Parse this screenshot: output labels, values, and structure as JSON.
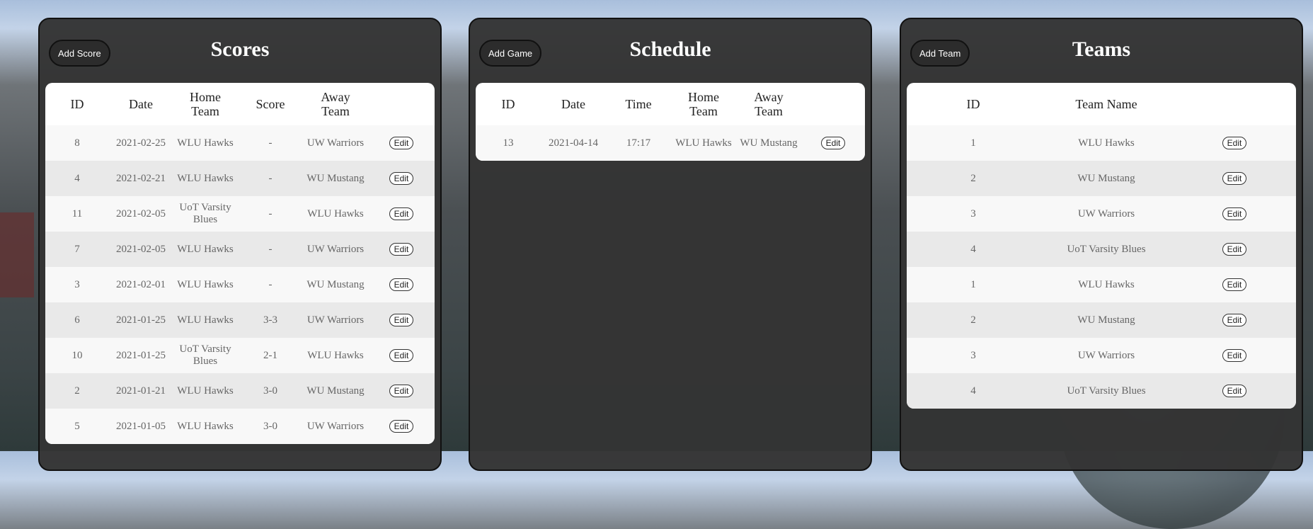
{
  "scores": {
    "title": "Scores",
    "add_label": "Add Score",
    "headers": [
      "ID",
      "Date",
      "Home Team",
      "Score",
      "Away Team"
    ],
    "edit_label": "Edit",
    "rows": [
      {
        "id": "8",
        "date": "2021-02-25",
        "home": "WLU Hawks",
        "score": "-",
        "away": "UW Warriors"
      },
      {
        "id": "4",
        "date": "2021-02-21",
        "home": "WLU Hawks",
        "score": "-",
        "away": "WU Mustang"
      },
      {
        "id": "11",
        "date": "2021-02-05",
        "home": "UoT Varsity Blues",
        "score": "-",
        "away": "WLU Hawks"
      },
      {
        "id": "7",
        "date": "2021-02-05",
        "home": "WLU Hawks",
        "score": "-",
        "away": "UW Warriors"
      },
      {
        "id": "3",
        "date": "2021-02-01",
        "home": "WLU Hawks",
        "score": "-",
        "away": "WU Mustang"
      },
      {
        "id": "6",
        "date": "2021-01-25",
        "home": "WLU Hawks",
        "score": "3-3",
        "away": "UW Warriors"
      },
      {
        "id": "10",
        "date": "2021-01-25",
        "home": "UoT Varsity Blues",
        "score": "2-1",
        "away": "WLU Hawks"
      },
      {
        "id": "2",
        "date": "2021-01-21",
        "home": "WLU Hawks",
        "score": "3-0",
        "away": "WU Mustang"
      },
      {
        "id": "5",
        "date": "2021-01-05",
        "home": "WLU Hawks",
        "score": "3-0",
        "away": "UW Warriors"
      }
    ]
  },
  "schedule": {
    "title": "Schedule",
    "add_label": "Add Game",
    "headers": [
      "ID",
      "Date",
      "Time",
      "Home Team",
      "Away Team"
    ],
    "edit_label": "Edit",
    "rows": [
      {
        "id": "13",
        "date": "2021-04-14",
        "time": "17:17",
        "home": "WLU Hawks",
        "away": "WU Mustang"
      }
    ]
  },
  "teams": {
    "title": "Teams",
    "add_label": "Add Team",
    "headers": [
      "ID",
      "Team Name"
    ],
    "edit_label": "Edit",
    "rows": [
      {
        "id": "1",
        "name": "WLU Hawks"
      },
      {
        "id": "2",
        "name": "WU Mustang"
      },
      {
        "id": "3",
        "name": "UW Warriors"
      },
      {
        "id": "4",
        "name": "UoT Varsity Blues"
      },
      {
        "id": "1",
        "name": "WLU Hawks"
      },
      {
        "id": "2",
        "name": "WU Mustang"
      },
      {
        "id": "3",
        "name": "UW Warriors"
      },
      {
        "id": "4",
        "name": "UoT Varsity Blues"
      }
    ]
  }
}
